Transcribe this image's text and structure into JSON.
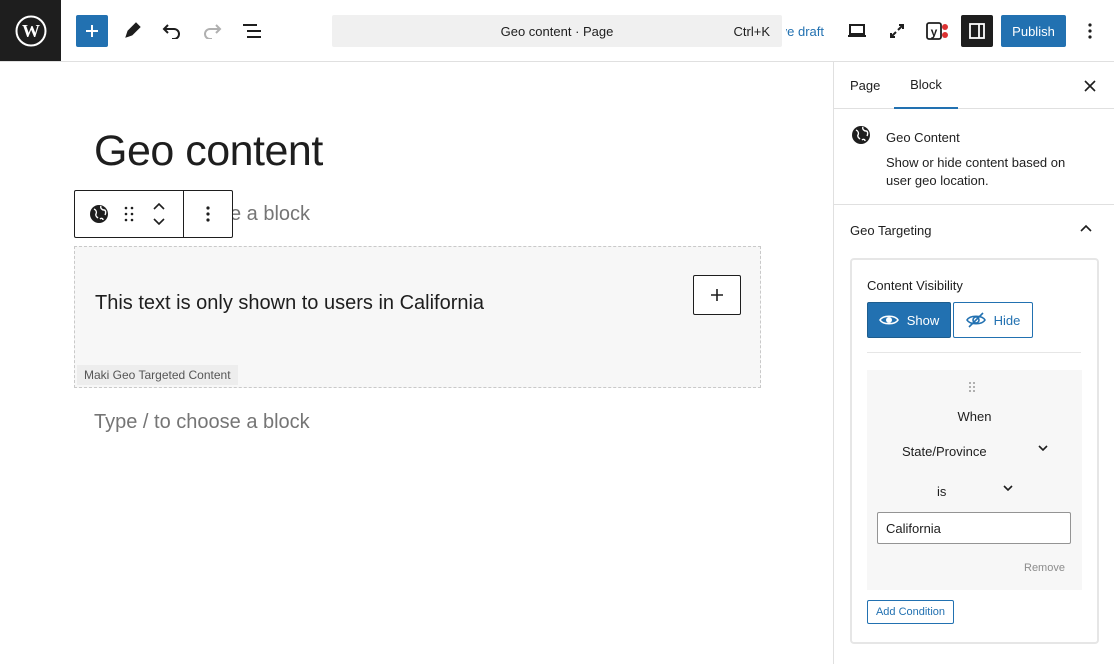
{
  "topbar": {
    "command_title": "Geo content · Page",
    "command_shortcut": "Ctrl+K",
    "save_draft": "Save draft",
    "publish": "Publish"
  },
  "canvas": {
    "page_title": "Geo content",
    "placeholder_partial": "e a block",
    "geo_text": "This text is only shown to users in California",
    "block_label": "Maki Geo Targeted Content",
    "placeholder": "Type / to choose a block"
  },
  "sidebar": {
    "tabs": [
      "Page",
      "Block"
    ],
    "active_tab": "Block",
    "block_name": "Geo Content",
    "block_description": "Show or hide content based on user geo location.",
    "panel_title": "Geo Targeting",
    "content_visibility_label": "Content Visibility",
    "show_label": "Show",
    "hide_label": "Hide",
    "selected_visibility": "Show",
    "condition": {
      "when_label": "When",
      "field": "State/Province",
      "operator": "is",
      "value": "California",
      "remove_label": "Remove"
    },
    "add_condition": "Add Condition"
  },
  "colors": {
    "accent": "#2271b1",
    "dark": "#1e1e1e"
  }
}
